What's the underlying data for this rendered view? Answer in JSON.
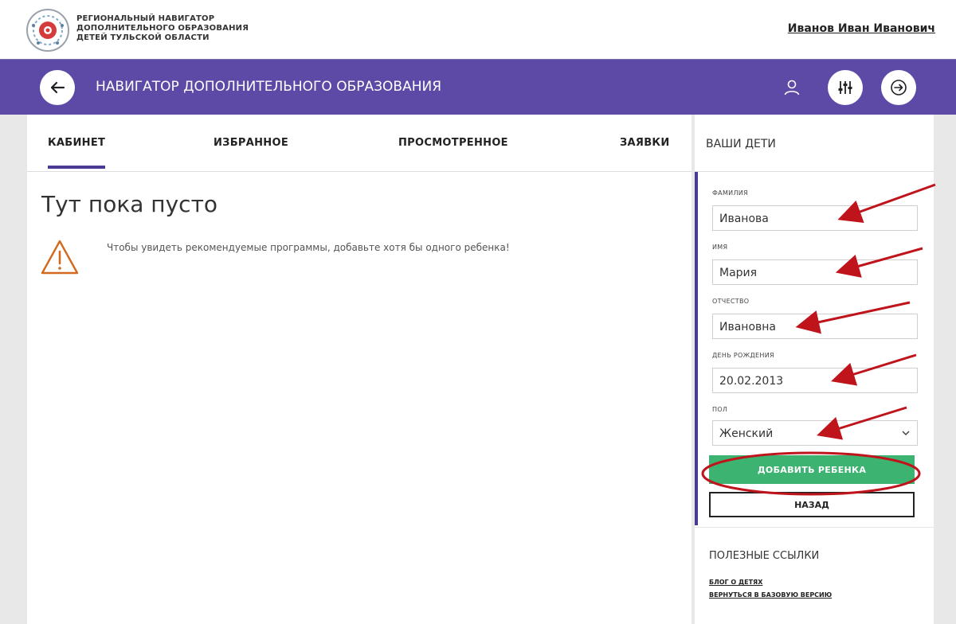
{
  "header": {
    "logo_lines": [
      "РЕГИОНАЛЬНЫЙ НАВИГАТОР",
      "ДОПОЛНИТЕЛЬНОГО ОБРАЗОВАНИЯ",
      "ДЕТЕЙ ТУЛЬСКОЙ ОБЛАСТИ"
    ],
    "user_name": "Иванов Иван Иванович"
  },
  "navbar": {
    "title": "НАВИГАТОР ДОПОЛНИТЕЛЬНОГО ОБРАЗОВАНИЯ",
    "icons": [
      "back-arrow-icon",
      "user-icon",
      "filter-sliders-icon",
      "exit-arrow-icon"
    ]
  },
  "tabs": [
    {
      "label": "КАБИНЕТ",
      "active": true
    },
    {
      "label": "ИЗБРАННОЕ",
      "active": false
    },
    {
      "label": "ПРОСМОТРЕННОЕ",
      "active": false
    },
    {
      "label": "ЗАЯВКИ",
      "active": false
    }
  ],
  "main": {
    "empty_title": "Тут пока пусто",
    "warning_text": "Чтобы увидеть рекомендуемые программы, добавьте хотя бы одного ребенка!"
  },
  "side": {
    "title": "ВАШИ ДЕТИ",
    "fields": [
      {
        "label": "фамилия",
        "value": "Иванова"
      },
      {
        "label": "имя",
        "value": "Мария"
      },
      {
        "label": "отчество",
        "value": "Ивановна"
      },
      {
        "label": "день рождения",
        "value": "20.02.2013"
      },
      {
        "label": "пол",
        "value": "Женский"
      }
    ],
    "add_button": "ДОБАВИТЬ РЕБЕНКА",
    "back_button": "НАЗАД",
    "links_title": "ПОЛЕЗНЫЕ ССЫЛКИ",
    "links": [
      "БЛОГ О ДЕТЯХ",
      "ВЕРНУТЬСЯ В БАЗОВУЮ ВЕРСИЮ"
    ]
  },
  "colors": {
    "nav_purple": "#5d4aa6",
    "accent_purple": "#4b3a94",
    "add_green": "#3cb371",
    "annotation_red": "#c0141c",
    "warning_orange": "#d2691e"
  }
}
